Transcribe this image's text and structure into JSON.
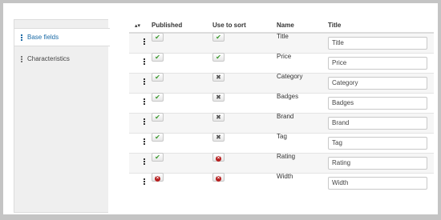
{
  "sidebar": {
    "tabs": [
      {
        "label": "Base fields",
        "active": true
      },
      {
        "label": "Characteristics",
        "active": false
      }
    ]
  },
  "table": {
    "headers": {
      "sort": "▴▾",
      "published": "Published",
      "use_to_sort": "Use to sort",
      "name": "Name",
      "title": "Title"
    },
    "rows": [
      {
        "published": "check",
        "use_to_sort": "check",
        "name": "Title",
        "title": "Title"
      },
      {
        "published": "check",
        "use_to_sort": "check",
        "name": "Price",
        "title": "Price"
      },
      {
        "published": "check",
        "use_to_sort": "cross",
        "name": "Category",
        "title": "Category"
      },
      {
        "published": "check",
        "use_to_sort": "cross",
        "name": "Badges",
        "title": "Badges"
      },
      {
        "published": "check",
        "use_to_sort": "cross",
        "name": "Brand",
        "title": "Brand"
      },
      {
        "published": "check",
        "use_to_sort": "cross",
        "name": "Tag",
        "title": "Tag"
      },
      {
        "published": "check",
        "use_to_sort": "error",
        "name": "Rating",
        "title": "Rating"
      },
      {
        "published": "error",
        "use_to_sort": "error",
        "name": "Width",
        "title": "Width"
      }
    ]
  },
  "icons": {
    "check": "✔",
    "cross": "✖",
    "error": "×"
  },
  "colors": {
    "check": "#3a9a2c",
    "error": "#b82020",
    "active_tab": "#1a6aa6"
  }
}
